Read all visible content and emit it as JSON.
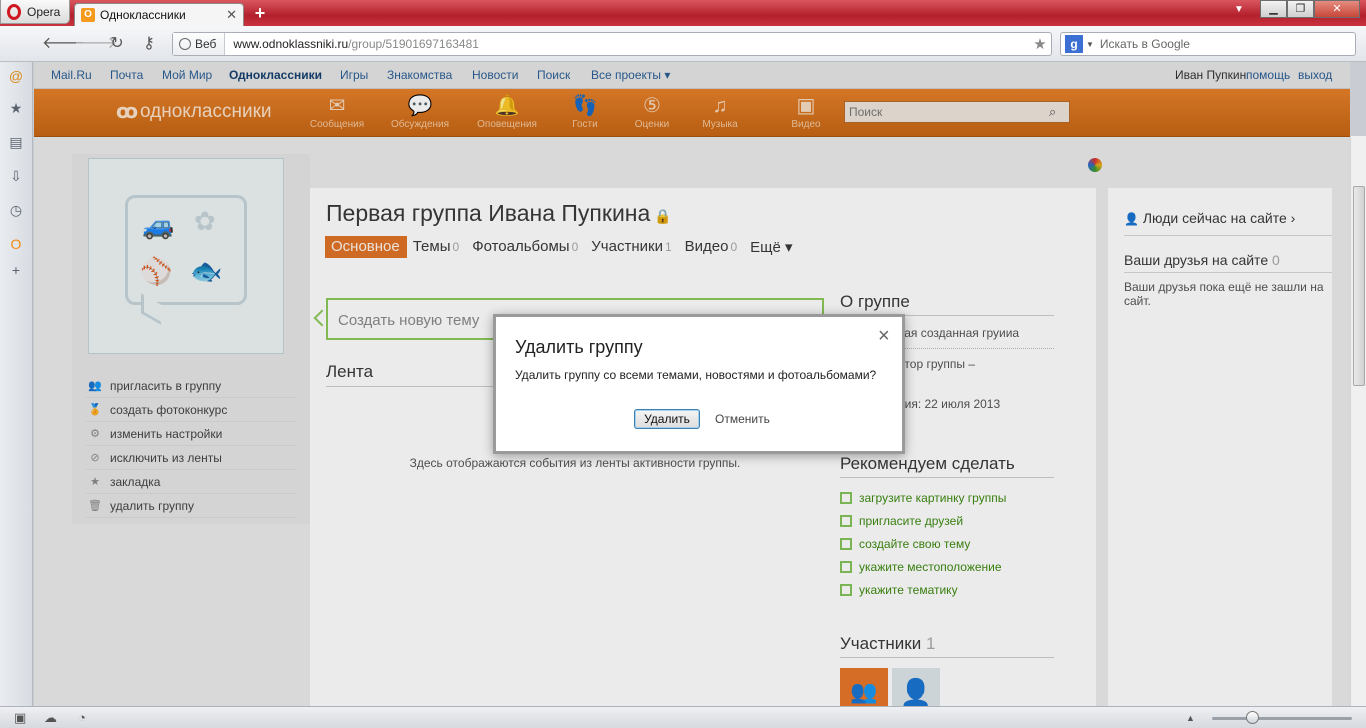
{
  "browser": {
    "menu_label": "Opera",
    "tab_label": "Одноклассники",
    "tab_favicon": "ok",
    "address_prefix": "Веб",
    "address_host": "www.odnoklassniki.ru",
    "address_path": "/group/51901697163481",
    "search_placeholder": "Искать в Google",
    "search_engine_letter": "g"
  },
  "topnav": {
    "items": [
      "Mail.Ru",
      "Почта",
      "Мой Мир",
      "Одноклассники",
      "Игры",
      "Знакомства",
      "Новости",
      "Поиск",
      "Все проекты ▾"
    ],
    "user_name": "Иван Пупкин",
    "help": "помощь",
    "logout": "выход"
  },
  "header": {
    "logo_text": "одноклассники",
    "nav": [
      "Сообщения",
      "Обсуждения",
      "Оповещения",
      "Гости",
      "Оценки",
      "Музыка",
      "Видео"
    ],
    "search_placeholder": "Поиск"
  },
  "group": {
    "title": "Первая группа Ивана Пупкина",
    "tabs": [
      {
        "label": "Основное",
        "count": ""
      },
      {
        "label": "Темы",
        "count": "0"
      },
      {
        "label": "Фотоальбомы",
        "count": "0"
      },
      {
        "label": "Участники",
        "count": "1"
      },
      {
        "label": "Видео",
        "count": "0"
      },
      {
        "label": "Ещё ▾",
        "count": ""
      }
    ],
    "new_topic_placeholder": "Создать новую тему",
    "feed_title": "Лента",
    "feed_empty": "Здесь отображаются события из ленты активности группы."
  },
  "left_menu": [
    "пригласить в группу",
    "создать фотоконкурс",
    "изменить настройки",
    "исключить из ленты",
    "закладка",
    "удалить группу"
  ],
  "about": {
    "title": "О группе",
    "description_fragment": "вая созданная груииа",
    "admin_fragment": "атор группы –",
    "admin_name_fragment": "н",
    "created_fragment": "ния: 22 июля 2013"
  },
  "recommend": {
    "title": "Рекомендуем сделать",
    "items": [
      "загрузите картинку группы",
      "пригласите друзей",
      "создайте свою тему",
      "укажите местоположение",
      "укажите тематику"
    ]
  },
  "participants": {
    "title": "Участники",
    "count": "1"
  },
  "right_panel": {
    "people_online": "Люди сейчас на сайте ›",
    "friends_title": "Ваши друзья на сайте",
    "friends_count": "0",
    "friends_none": "Ваши друзья пока ещё не зашли на сайт."
  },
  "modal": {
    "title": "Удалить группу",
    "text": "Удалить группу со всеми темами, новостями и фотоальбомами?",
    "confirm": "Удалить",
    "cancel": "Отменить",
    "close_glyph": "×"
  },
  "colors": {
    "brand_orange": "#e07428",
    "link_blue": "#2b5f96",
    "recommend_green": "#3e8a12",
    "opera_red": "#b3202c"
  }
}
